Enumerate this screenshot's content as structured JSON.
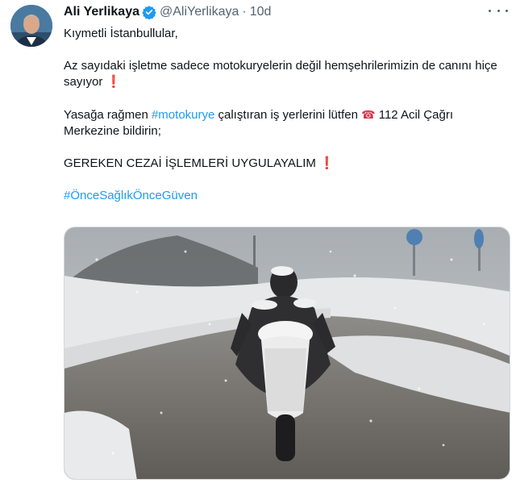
{
  "author": {
    "name": "Ali Yerlikaya",
    "handle": "@AliYerlikaya",
    "time": "10d"
  },
  "tweet": {
    "line1": "Kıymetli İstanbullular,",
    "para2": "Az sayıdaki işletme sadece motokuryelerin değil hemşehrilerimizin de canını hiçe sayıyor",
    "para3_a": "Yasağa rağmen ",
    "para3_tag": "#motokurye",
    "para3_b": " çalıştıran iş yerlerini lütfen ",
    "para3_c": " 112 Acil Çağrı Merkezine bildirin;",
    "para4": "GEREKEN CEZAİ İŞLEMLERİ UYGULAYALIM",
    "hashtag": "#ÖnceSağlıkÖnceGüven",
    "exclaim": "❗",
    "phone_icon": "☎"
  },
  "icons": {
    "verified": "verified-badge-icon",
    "more": "more-options-icon"
  },
  "colors": {
    "link": "#1d9bf0",
    "verified": "#1d9bf0",
    "secondary_text": "#536471"
  }
}
